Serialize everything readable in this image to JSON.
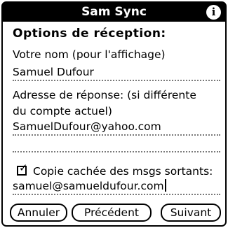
{
  "window": {
    "title": "Sam Sync",
    "info_icon": "i"
  },
  "form": {
    "heading": "Options de réception:",
    "display_name_label": "Votre nom (pour l'affichage)",
    "display_name_value": "Samuel Dufour",
    "reply_label_line1": "Adresse de réponse:  (si différente",
    "reply_label_line2": "du compte actuel)",
    "reply_address_value": "SamuelDufour@yahoo.com",
    "reply_extra_value": "",
    "bcc_checked": true,
    "bcc_label": "Copie cachée des msgs sortants:",
    "bcc_value": "samuel@samueldufour.com"
  },
  "buttons": {
    "cancel": "Annuler",
    "previous": "Précédent",
    "next": "Suivant"
  }
}
